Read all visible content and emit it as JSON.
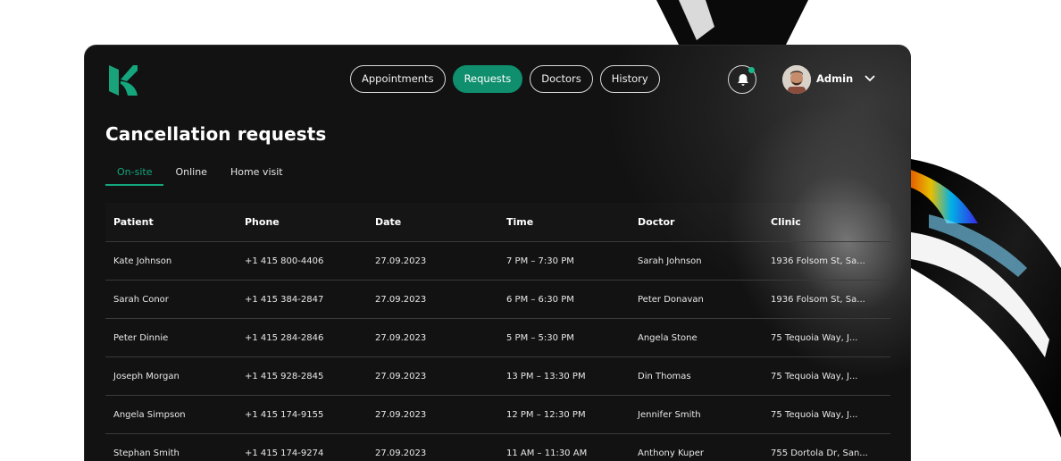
{
  "nav": {
    "items": [
      {
        "label": "Appointments",
        "active": false
      },
      {
        "label": "Requests",
        "active": true
      },
      {
        "label": "Doctors",
        "active": false
      },
      {
        "label": "History",
        "active": false
      }
    ]
  },
  "user": {
    "name": "Admin",
    "avatar_icon": "user-avatar",
    "menu_icon": "chevron-down-icon"
  },
  "notifications": {
    "icon": "bell-icon",
    "has_unread": true
  },
  "page": {
    "title": "Cancellation requests"
  },
  "tabs": [
    {
      "label": "On-site",
      "active": true
    },
    {
      "label": "Online",
      "active": false
    },
    {
      "label": "Home visit",
      "active": false
    }
  ],
  "table": {
    "columns": [
      "Patient",
      "Phone",
      "Date",
      "Time",
      "Doctor",
      "Clinic"
    ],
    "rows": [
      [
        "Kate Johnson",
        "+1 415 800-4406",
        "27.09.2023",
        "7 PM – 7:30 PM",
        "Sarah Johnson",
        "1936 Folsom St, Sa..."
      ],
      [
        "Sarah Conor",
        "+1 415 384-2847",
        "27.09.2023",
        "6 PM – 6:30 PM",
        "Peter Donavan",
        "1936 Folsom St, Sa..."
      ],
      [
        "Peter Dinnie",
        "+1 415 284-2846",
        "27.09.2023",
        "5 PM – 5:30 PM",
        "Angela Stone",
        "75 Tequoia Way, J..."
      ],
      [
        "Joseph Morgan",
        "+1 415 928-2845",
        "27.09.2023",
        "13 PM – 13:30 PM",
        "Din Thomas",
        "75 Tequoia Way, J..."
      ],
      [
        "Angela Simpson",
        "+1 415 174-9155",
        "27.09.2023",
        "12 PM – 12:30 PM",
        "Jennifer Smith",
        "75 Tequoia Way, J..."
      ],
      [
        "Stephan Smith",
        "+1 415 174-9274",
        "27.09.2023",
        "11 AM – 11:30 AM",
        "Anthony Kuper",
        "755 Dortola Dr, San..."
      ]
    ]
  },
  "colors": {
    "accent": "#0f8f6d",
    "background": "#111111",
    "text": "#ffffff"
  }
}
